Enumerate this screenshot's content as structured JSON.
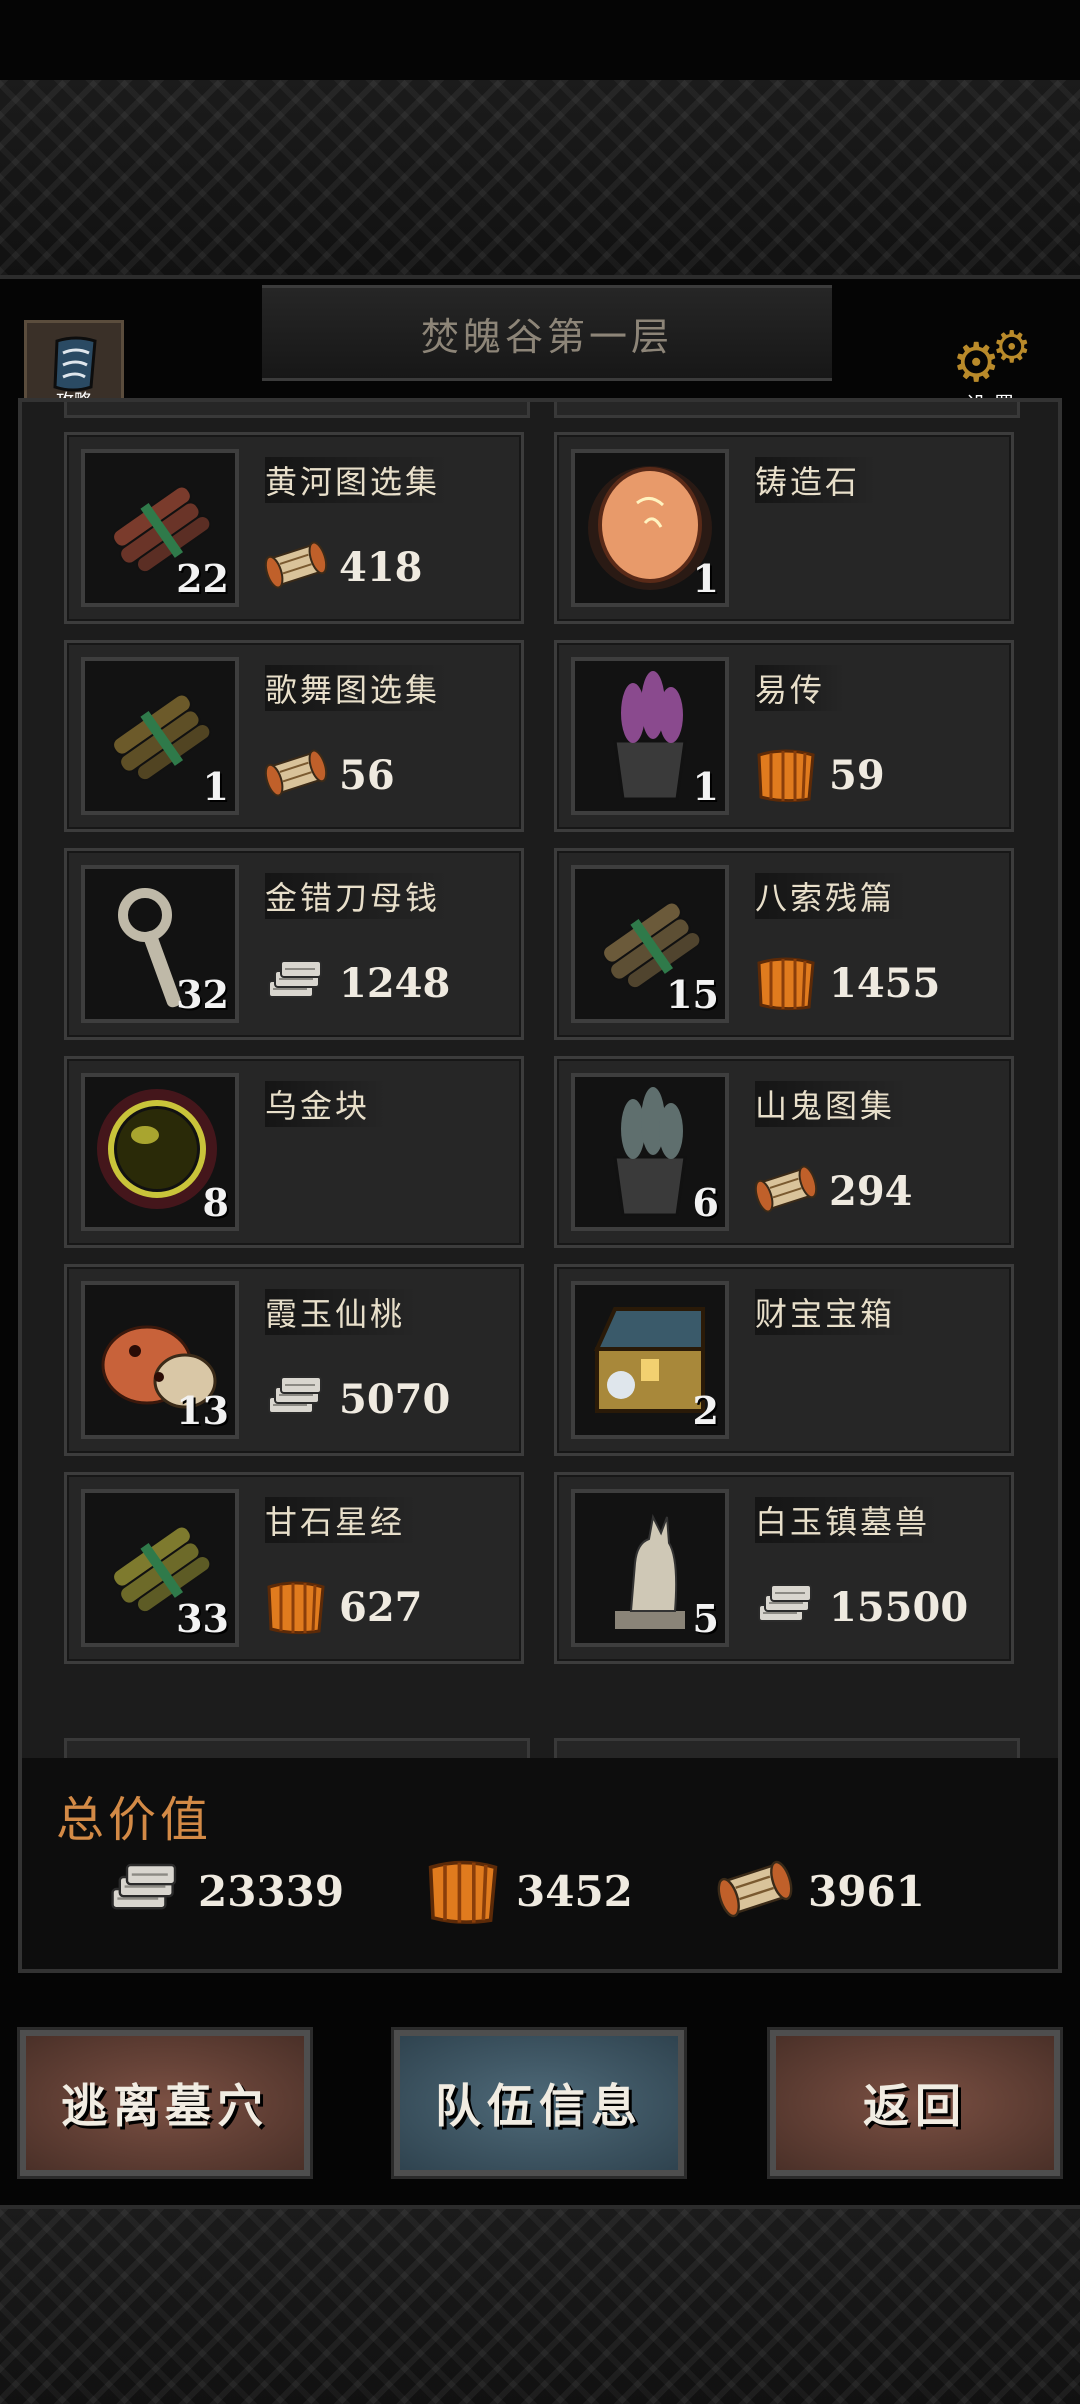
{
  "header": {
    "title": "焚魄谷第一层",
    "guide_label": "攻略",
    "settings_label": "设置"
  },
  "items": [
    {
      "name": "黄河图选集",
      "qty": "22",
      "price": "418",
      "currency": "scroll-currency-icon",
      "art": "bundle",
      "color": "#7a3b2c"
    },
    {
      "name": "铸造石",
      "qty": "1",
      "price": "",
      "currency": "",
      "art": "orb",
      "color": "#e89a6a"
    },
    {
      "name": "歌舞图选集",
      "qty": "1",
      "price": "56",
      "currency": "scroll-currency-icon",
      "art": "bundle",
      "color": "#6c5a2a"
    },
    {
      "name": "易传",
      "qty": "1",
      "price": "59",
      "currency": "bamboo-currency-icon",
      "art": "pot",
      "color": "#8a4a8e"
    },
    {
      "name": "金错刀母钱",
      "qty": "32",
      "price": "1248",
      "currency": "silver-currency-icon",
      "art": "key",
      "color": "#bfb9a8"
    },
    {
      "name": "八索残篇",
      "qty": "15",
      "price": "1455",
      "currency": "bamboo-currency-icon",
      "art": "bundle",
      "color": "#6b5a3a"
    },
    {
      "name": "乌金块",
      "qty": "8",
      "price": "",
      "currency": "",
      "art": "sphere",
      "color": "#c9c43a"
    },
    {
      "name": "山鬼图集",
      "qty": "6",
      "price": "294",
      "currency": "scroll-currency-icon",
      "art": "pot",
      "color": "#5f6f6e"
    },
    {
      "name": "霞玉仙桃",
      "qty": "13",
      "price": "5070",
      "currency": "silver-currency-icon",
      "art": "peach",
      "color": "#c8623a"
    },
    {
      "name": "财宝宝箱",
      "qty": "2",
      "price": "",
      "currency": "",
      "art": "chest",
      "color": "#a8883a"
    },
    {
      "name": "甘石星经",
      "qty": "33",
      "price": "627",
      "currency": "bamboo-currency-icon",
      "art": "bundle",
      "color": "#7e7a2e"
    },
    {
      "name": "白玉镇墓兽",
      "qty": "5",
      "price": "15500",
      "currency": "silver-currency-icon",
      "art": "statue",
      "color": "#cfc8b6"
    }
  ],
  "totals": {
    "label": "总价值",
    "silver": "23339",
    "bamboo": "3452",
    "scroll": "3961"
  },
  "buttons": {
    "escape": "逃离墓穴",
    "team": "队伍信息",
    "back": "返回"
  },
  "colors": {
    "accent": "#d38a46",
    "button_red": "#6a4034",
    "button_blue": "#42596a"
  }
}
